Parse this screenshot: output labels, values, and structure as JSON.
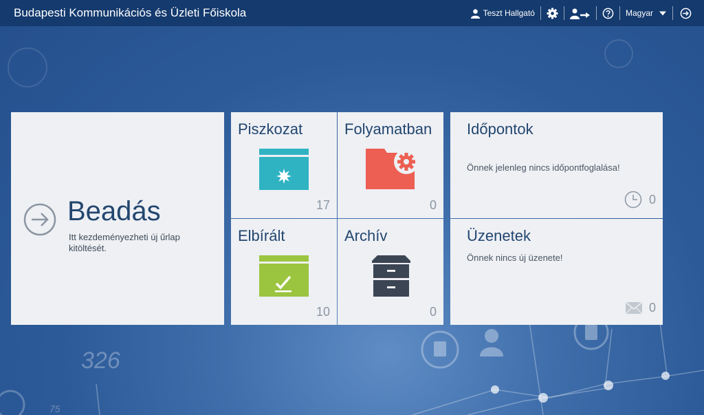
{
  "app": {
    "title": "Budapesti Kommunikációs és Üzleti Főiskola"
  },
  "nav": {
    "user": "Teszt Hallgató",
    "language": "Magyar"
  },
  "tiles": {
    "submit": {
      "title": "Beadás",
      "subtitle": "Itt kezdeményezheti új űrlap kitöltését."
    },
    "draft": {
      "title": "Piszkozat",
      "count": "17"
    },
    "in_progress": {
      "title": "Folyamatban",
      "count": "0"
    },
    "evaluated": {
      "title": "Elbírált",
      "count": "10"
    },
    "archive": {
      "title": "Archív",
      "count": "0"
    },
    "appointments": {
      "title": "Időpontok",
      "text": "Önnek jelenleg nincs időpontfoglalása!",
      "count": "0"
    },
    "messages": {
      "title": "Üzenetek",
      "text": "Önnek nincs új üzenete!",
      "count": "0"
    }
  },
  "background": {
    "numbers": [
      "326",
      "75"
    ]
  },
  "colors": {
    "topbar": "#143a6e",
    "draft": "#2fb3c3",
    "in_progress": "#ec5f52",
    "evaluated": "#9bc43f",
    "archive": "#3c4554",
    "title_text": "#23466f"
  },
  "icons": [
    "user-icon",
    "gear-icon",
    "user-switch-icon",
    "help-icon",
    "caret-down-icon",
    "logout-icon",
    "arrow-right-circle-icon",
    "folder-star-icon",
    "folder-gear-icon",
    "folder-check-icon",
    "archive-box-icon",
    "clock-icon",
    "mail-icon"
  ]
}
